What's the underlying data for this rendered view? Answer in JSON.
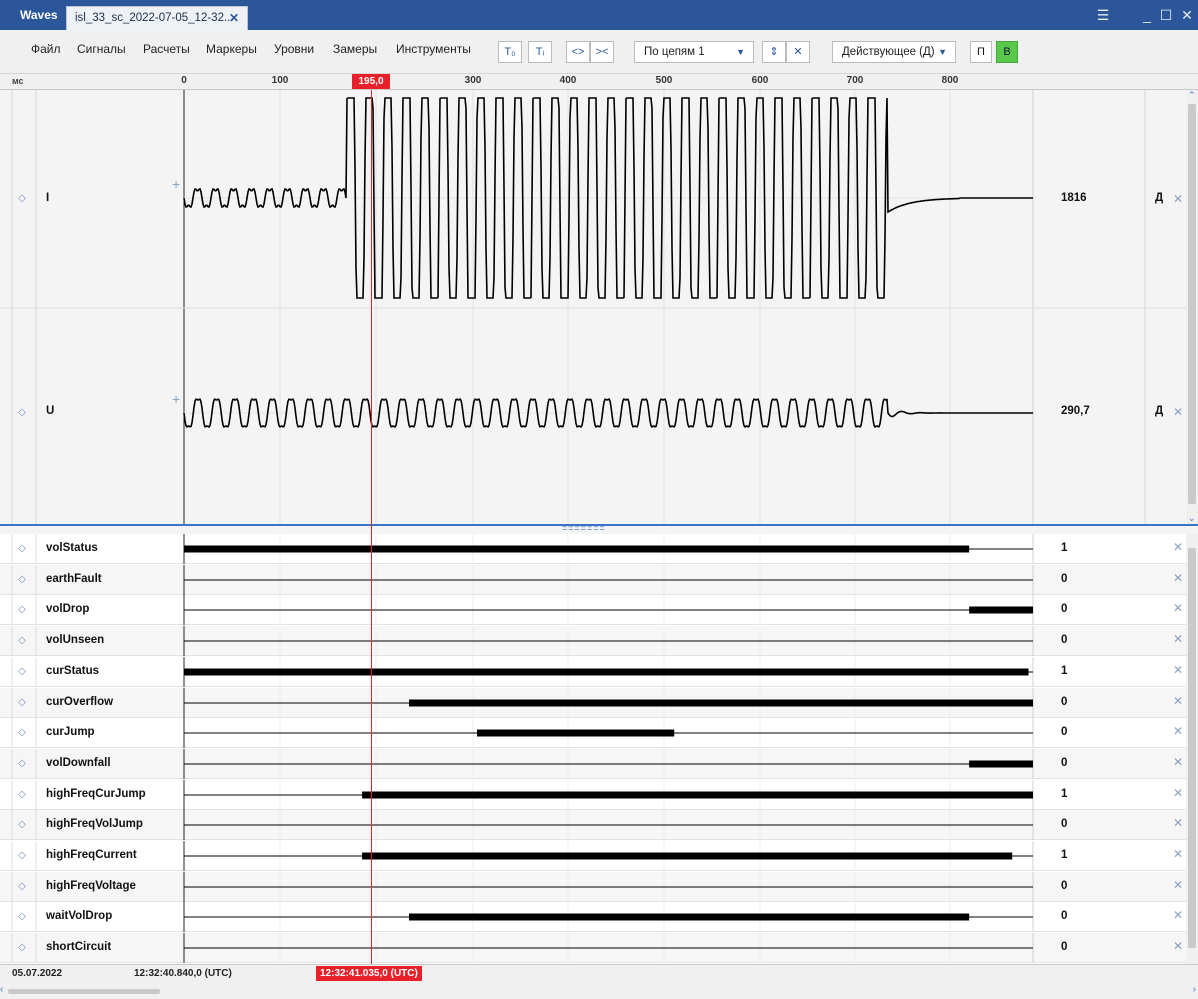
{
  "window": {
    "app_name": "Waves",
    "tab_label": "isl_33_sc_2022-07-05_12-32...",
    "hamburger": "☰",
    "minimize": "_",
    "maximize": "☐",
    "close": "✕"
  },
  "menu": {
    "items": [
      "Файл",
      "Сигналы",
      "Расчеты",
      "Маркеры",
      "Уровни",
      "Замеры",
      "Инструменты"
    ]
  },
  "toolbar": {
    "t0": "T₀",
    "ti": "Tᵢ",
    "expand": "<>",
    "collapse": "><",
    "group_select": "По цепям 1",
    "value_mode": "Действующее (Д)",
    "p_label": "П",
    "v_label": "В",
    "accent_green": "#57c84a"
  },
  "ruler": {
    "unit": "мс",
    "ticks": [
      "0",
      "100",
      "300",
      "400",
      "500",
      "600",
      "700",
      "800"
    ],
    "cursor_value": "195,0",
    "cursor_color": "#e8202a"
  },
  "analog": [
    {
      "name": "I",
      "value": "1816",
      "mode": "Д"
    },
    {
      "name": "U",
      "value": "290,7",
      "mode": "Д"
    }
  ],
  "digital": [
    {
      "name": "volStatus",
      "value": "1",
      "on": [
        [
          0,
          820
        ]
      ]
    },
    {
      "name": "earthFault",
      "value": "0",
      "on": []
    },
    {
      "name": "volDrop",
      "value": "0",
      "on": [
        [
          820,
          910
        ]
      ]
    },
    {
      "name": "volUnseen",
      "value": "0",
      "on": []
    },
    {
      "name": "curStatus",
      "value": "1",
      "on": [
        [
          0,
          882
        ]
      ]
    },
    {
      "name": "curOverflow",
      "value": "0",
      "on": [
        [
          235,
          910
        ]
      ]
    },
    {
      "name": "curJump",
      "value": "0",
      "on": [
        [
          306,
          512
        ]
      ]
    },
    {
      "name": "volDownfall",
      "value": "0",
      "on": [
        [
          820,
          910
        ]
      ]
    },
    {
      "name": "highFreqCurJump",
      "value": "1",
      "on": [
        [
          186,
          910
        ]
      ]
    },
    {
      "name": "highFreqVolJump",
      "value": "0",
      "on": []
    },
    {
      "name": "highFreqCurrent",
      "value": "1",
      "on": [
        [
          186,
          865
        ]
      ]
    },
    {
      "name": "highFreqVoltage",
      "value": "0",
      "on": []
    },
    {
      "name": "waitVolDrop",
      "value": "0",
      "on": [
        [
          235,
          820
        ]
      ]
    },
    {
      "name": "shortCircuit",
      "value": "0",
      "on": []
    }
  ],
  "status": {
    "date": "05.07.2022",
    "start_time": "12:32:40.840,0 (UTC)",
    "cursor_time": "12:32:41.035,0 (UTC)"
  }
}
